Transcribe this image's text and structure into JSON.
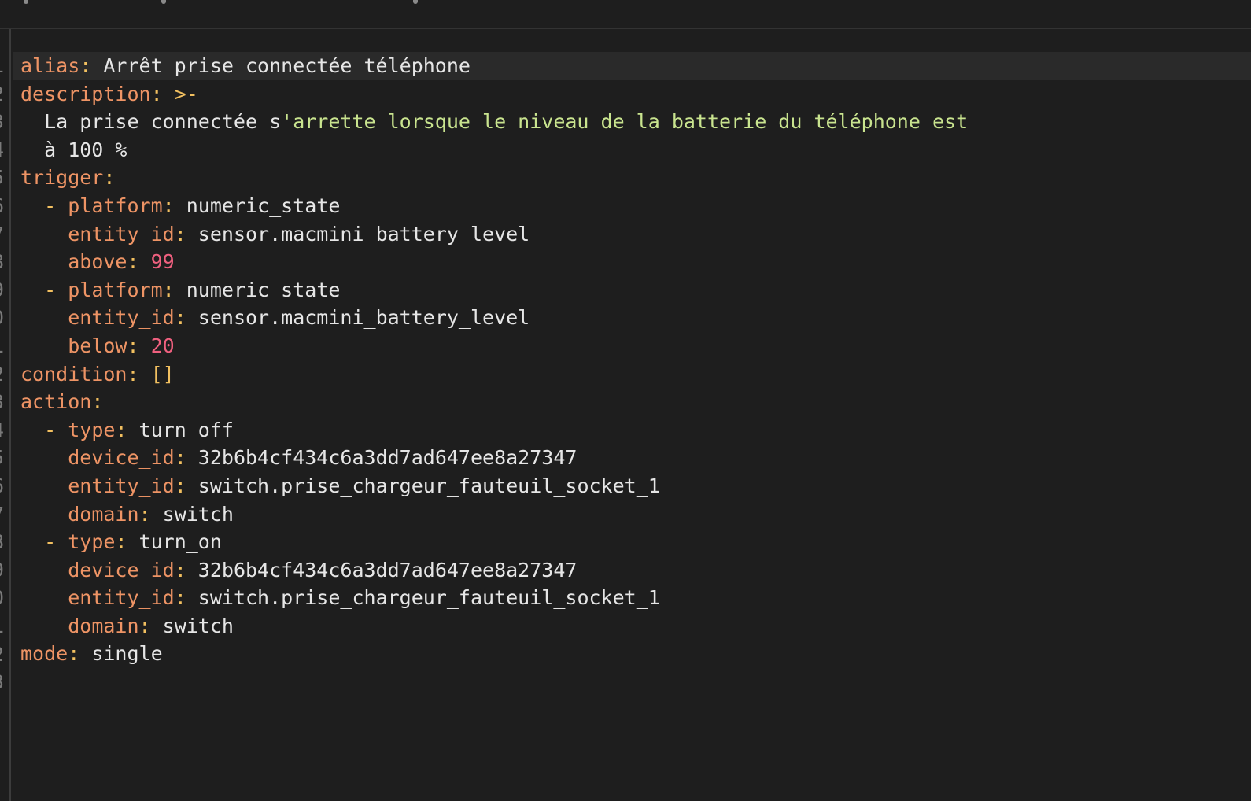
{
  "editor": {
    "line_numbers": [
      "1",
      "2",
      "3",
      "4",
      "5",
      "6",
      "7",
      "8",
      "9",
      "0",
      "1",
      "2",
      "3",
      "4",
      "5",
      "6",
      "7",
      "8",
      "9",
      "0",
      "1",
      "2",
      "3"
    ],
    "lines": [
      [
        {
          "t": "k",
          "v": "alias"
        },
        {
          "t": "p",
          "v": ": "
        },
        {
          "t": "s",
          "v": "Arrêt prise connectée téléphone"
        }
      ],
      [
        {
          "t": "k",
          "v": "description"
        },
        {
          "t": "p",
          "v": ": >-"
        }
      ],
      [
        {
          "t": "s",
          "v": "  La prise connectée s"
        },
        {
          "t": "g",
          "v": "'arrette lorsque le niveau de la batterie du téléphone est"
        }
      ],
      [
        {
          "t": "s",
          "v": "  à 100 %"
        }
      ],
      [
        {
          "t": "k",
          "v": "trigger"
        },
        {
          "t": "p",
          "v": ":"
        }
      ],
      [
        {
          "t": "p",
          "v": "  - "
        },
        {
          "t": "k",
          "v": "platform"
        },
        {
          "t": "p",
          "v": ": "
        },
        {
          "t": "s",
          "v": "numeric_state"
        }
      ],
      [
        {
          "t": "s",
          "v": "    "
        },
        {
          "t": "k",
          "v": "entity_id"
        },
        {
          "t": "p",
          "v": ": "
        },
        {
          "t": "s",
          "v": "sensor.macmini_battery_level"
        }
      ],
      [
        {
          "t": "s",
          "v": "    "
        },
        {
          "t": "k",
          "v": "above"
        },
        {
          "t": "p",
          "v": ": "
        },
        {
          "t": "n",
          "v": "99"
        }
      ],
      [
        {
          "t": "p",
          "v": "  - "
        },
        {
          "t": "k",
          "v": "platform"
        },
        {
          "t": "p",
          "v": ": "
        },
        {
          "t": "s",
          "v": "numeric_state"
        }
      ],
      [
        {
          "t": "s",
          "v": "    "
        },
        {
          "t": "k",
          "v": "entity_id"
        },
        {
          "t": "p",
          "v": ": "
        },
        {
          "t": "s",
          "v": "sensor.macmini_battery_level"
        }
      ],
      [
        {
          "t": "s",
          "v": "    "
        },
        {
          "t": "k",
          "v": "below"
        },
        {
          "t": "p",
          "v": ": "
        },
        {
          "t": "n",
          "v": "20"
        }
      ],
      [
        {
          "t": "k",
          "v": "condition"
        },
        {
          "t": "p",
          "v": ": []"
        }
      ],
      [
        {
          "t": "k",
          "v": "action"
        },
        {
          "t": "p",
          "v": ":"
        }
      ],
      [
        {
          "t": "p",
          "v": "  - "
        },
        {
          "t": "k",
          "v": "type"
        },
        {
          "t": "p",
          "v": ": "
        },
        {
          "t": "s",
          "v": "turn_off"
        }
      ],
      [
        {
          "t": "s",
          "v": "    "
        },
        {
          "t": "k",
          "v": "device_id"
        },
        {
          "t": "p",
          "v": ": "
        },
        {
          "t": "s",
          "v": "32b6b4cf434c6a3dd7ad647ee8a27347"
        }
      ],
      [
        {
          "t": "s",
          "v": "    "
        },
        {
          "t": "k",
          "v": "entity_id"
        },
        {
          "t": "p",
          "v": ": "
        },
        {
          "t": "s",
          "v": "switch.prise_chargeur_fauteuil_socket_1"
        }
      ],
      [
        {
          "t": "s",
          "v": "    "
        },
        {
          "t": "k",
          "v": "domain"
        },
        {
          "t": "p",
          "v": ": "
        },
        {
          "t": "s",
          "v": "switch"
        }
      ],
      [
        {
          "t": "p",
          "v": "  - "
        },
        {
          "t": "k",
          "v": "type"
        },
        {
          "t": "p",
          "v": ": "
        },
        {
          "t": "s",
          "v": "turn_on"
        }
      ],
      [
        {
          "t": "s",
          "v": "    "
        },
        {
          "t": "k",
          "v": "device_id"
        },
        {
          "t": "p",
          "v": ": "
        },
        {
          "t": "s",
          "v": "32b6b4cf434c6a3dd7ad647ee8a27347"
        }
      ],
      [
        {
          "t": "s",
          "v": "    "
        },
        {
          "t": "k",
          "v": "entity_id"
        },
        {
          "t": "p",
          "v": ": "
        },
        {
          "t": "s",
          "v": "switch.prise_chargeur_fauteuil_socket_1"
        }
      ],
      [
        {
          "t": "s",
          "v": "    "
        },
        {
          "t": "k",
          "v": "domain"
        },
        {
          "t": "p",
          "v": ": "
        },
        {
          "t": "s",
          "v": "switch"
        }
      ],
      [
        {
          "t": "k",
          "v": "mode"
        },
        {
          "t": "p",
          "v": ": "
        },
        {
          "t": "s",
          "v": "single"
        }
      ],
      []
    ],
    "active_line": 0
  }
}
